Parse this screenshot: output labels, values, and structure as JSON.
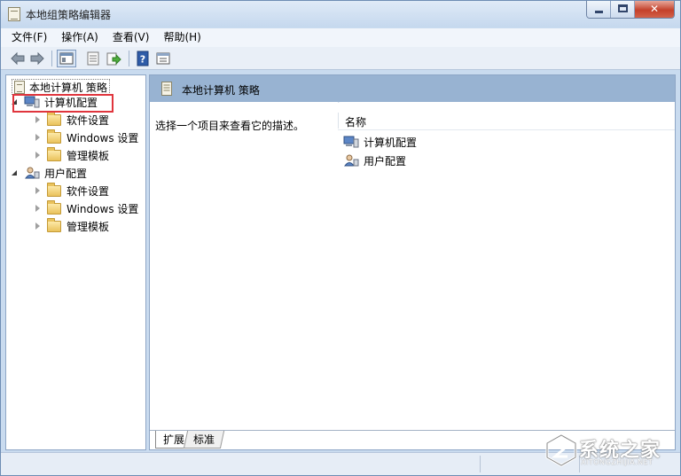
{
  "window": {
    "title": "本地组策略编辑器"
  },
  "menu": [
    "文件(F)",
    "操作(A)",
    "查看(V)",
    "帮助(H)"
  ],
  "toolbar": {
    "icons": [
      "back-arrow-icon",
      "forward-arrow-icon",
      "show-hide-tree-icon",
      "properties-icon",
      "export-list-icon",
      "help-icon",
      "filter-icon"
    ]
  },
  "tree": {
    "root": "本地计算机 策略",
    "computer_config": "计算机配置",
    "user_config": "用户配置",
    "computer_children": [
      "软件设置",
      "Windows 设置",
      "管理模板"
    ],
    "user_children": [
      "软件设置",
      "Windows 设置",
      "管理模板"
    ]
  },
  "detail": {
    "header": "本地计算机 策略",
    "description": "选择一个项目来查看它的描述。",
    "column_name": "名称",
    "items": [
      "计算机配置",
      "用户配置"
    ]
  },
  "tabs": {
    "extended": "扩展",
    "standard": "标准"
  },
  "watermark": {
    "text": "系统之家",
    "url": "XITONGZHIJIA.NET"
  },
  "colors": {
    "highlight_border": "#e0353d",
    "header_band": "#98b3d2"
  }
}
